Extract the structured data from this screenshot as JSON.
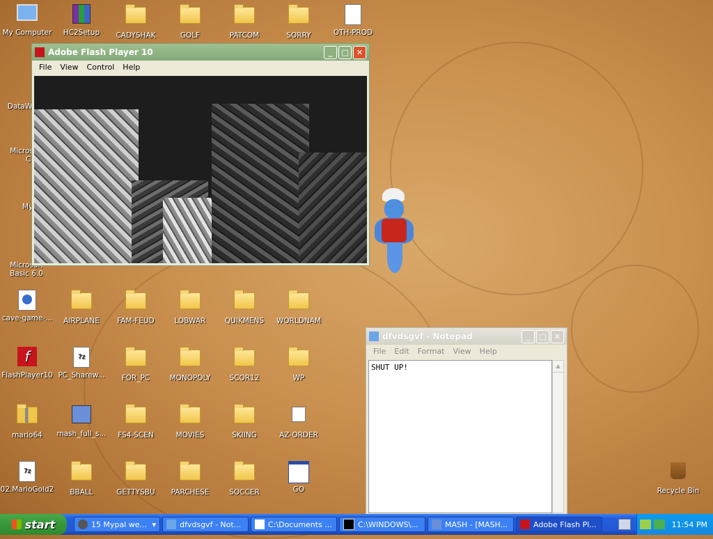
{
  "desktop": {
    "icons": [
      {
        "label": "My Computer",
        "type": "computer"
      },
      {
        "label": "HC2Setup",
        "type": "archive"
      },
      {
        "label": "CADYSHAK",
        "type": "folder"
      },
      {
        "label": "GOLF",
        "type": "folder"
      },
      {
        "label": "PATCOM",
        "type": "folder"
      },
      {
        "label": "SORRY",
        "type": "folder"
      },
      {
        "label": "OTH-PROD",
        "type": "file"
      },
      {
        "label": "DataWa",
        "type": "shortcut"
      },
      {
        "label": "Microsoft C++",
        "type": "shortcut"
      },
      {
        "label": "Myp",
        "type": "shortcut"
      },
      {
        "label": "Microsoft Basic 6.0",
        "type": "shortcut"
      },
      {
        "label": "cave-game-...",
        "type": "media"
      },
      {
        "label": "AIRPLANE",
        "type": "folder"
      },
      {
        "label": "FAM-FEUD",
        "type": "folder"
      },
      {
        "label": "LOBWAR",
        "type": "folder"
      },
      {
        "label": "QUIKMENS",
        "type": "folder"
      },
      {
        "label": "WORLDNAM",
        "type": "folder"
      },
      {
        "label": "FlashPlayer10",
        "type": "flash"
      },
      {
        "label": "PC_Sharew...",
        "type": "7z"
      },
      {
        "label": "FOR_PC",
        "type": "folder"
      },
      {
        "label": "MONOPOLY",
        "type": "folder"
      },
      {
        "label": "SCOR12",
        "type": "folder"
      },
      {
        "label": "WP",
        "type": "folder"
      },
      {
        "label": "mario64",
        "type": "zip"
      },
      {
        "label": "mash_full_s...",
        "type": "installer"
      },
      {
        "label": "FS4-SCEN",
        "type": "folder"
      },
      {
        "label": "MOVIES",
        "type": "folder"
      },
      {
        "label": "SKIING",
        "type": "folder"
      },
      {
        "label": "AZ-ORDER",
        "type": "file"
      },
      {
        "label": "02.MarioGold2",
        "type": "7z"
      },
      {
        "label": "BBALL",
        "type": "folder"
      },
      {
        "label": "GETTYSBU",
        "type": "folder"
      },
      {
        "label": "PARCHESE",
        "type": "folder"
      },
      {
        "label": "SOCCER",
        "type": "folder"
      },
      {
        "label": "GO",
        "type": "program"
      },
      {
        "label": "Recycle Bin",
        "type": "recycle"
      }
    ]
  },
  "flash_window": {
    "title": "Adobe Flash Player 10",
    "menu": [
      "File",
      "View",
      "Control",
      "Help"
    ]
  },
  "notepad_window": {
    "title": "dfvdsgvf - Notepad",
    "menu": [
      "File",
      "Edit",
      "Format",
      "View",
      "Help"
    ],
    "content": "SHUT UP!"
  },
  "taskbar": {
    "start_label": "start",
    "tasks": [
      {
        "label": "15 Mypal we...",
        "active": false
      },
      {
        "label": "dfvdsgvf - Not...",
        "active": false
      },
      {
        "label": "C:\\Documents ...",
        "active": false
      },
      {
        "label": "C:\\WINDOWS\\...",
        "active": false
      },
      {
        "label": "MASH - [MASH...",
        "active": false
      },
      {
        "label": "Adobe Flash Pl...",
        "active": true
      }
    ],
    "clock": "11:54 PM"
  }
}
